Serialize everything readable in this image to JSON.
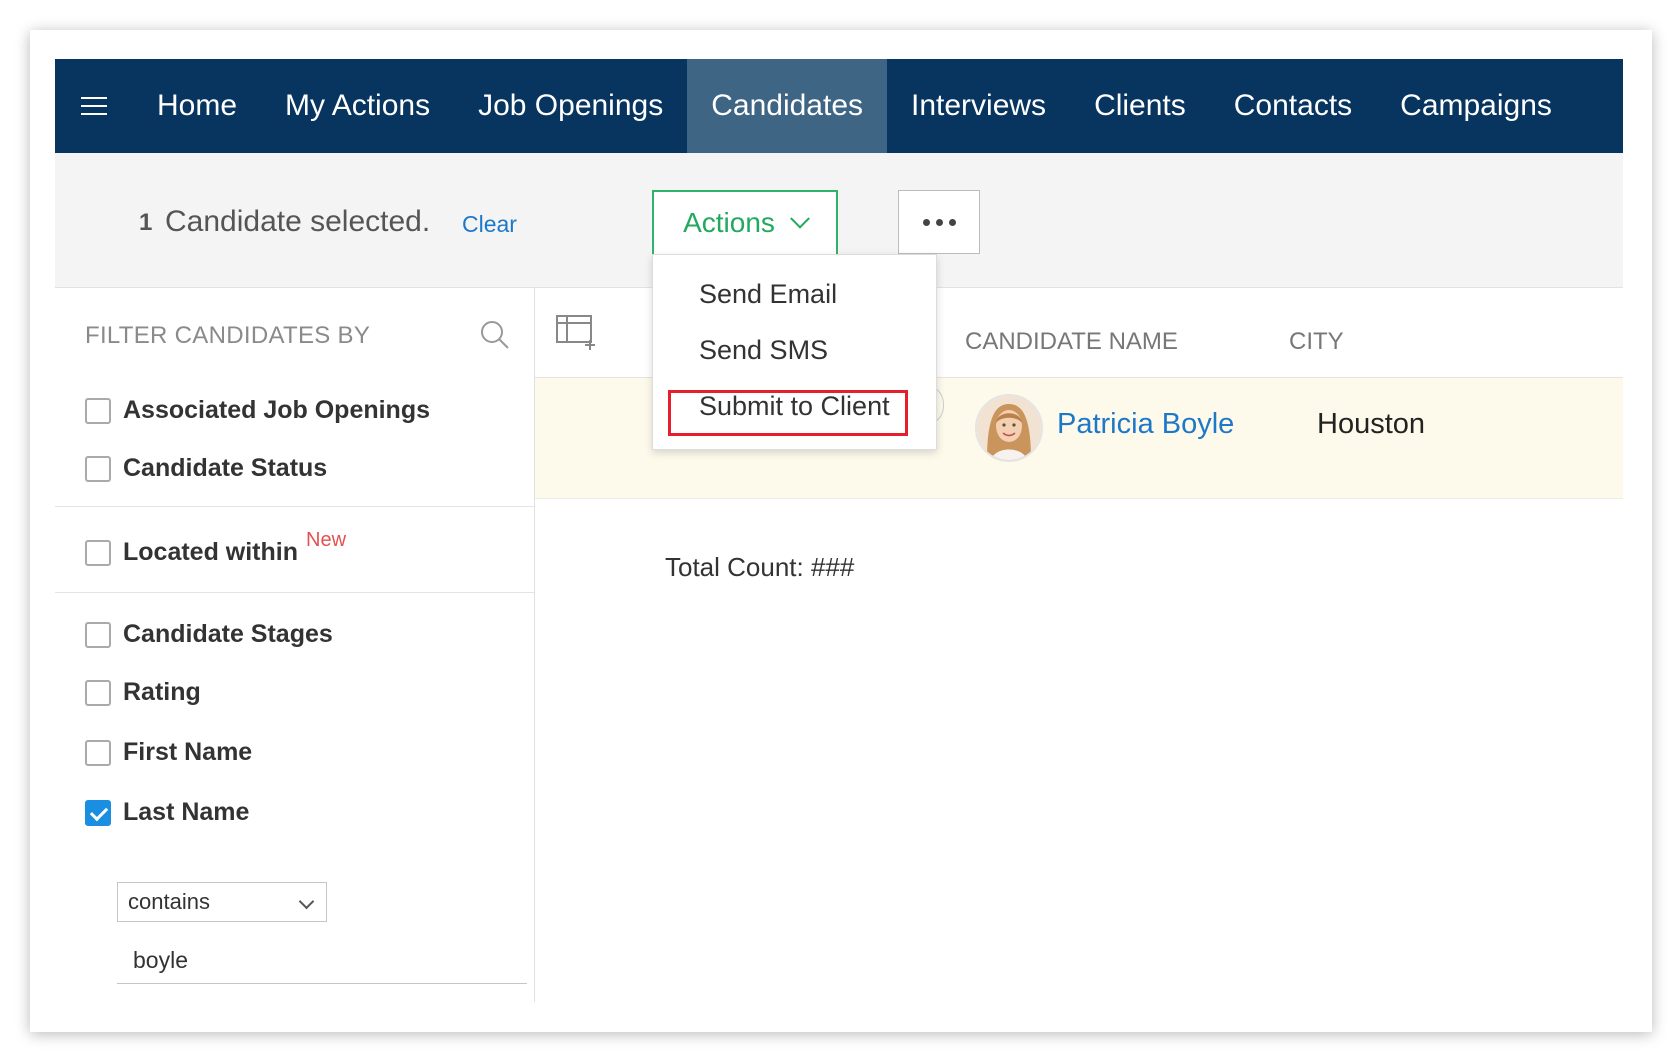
{
  "nav": {
    "items": [
      {
        "label": "Home"
      },
      {
        "label": "My Actions"
      },
      {
        "label": "Job Openings"
      },
      {
        "label": "Candidates"
      },
      {
        "label": "Interviews"
      },
      {
        "label": "Clients"
      },
      {
        "label": "Contacts"
      },
      {
        "label": "Campaigns"
      }
    ],
    "active": "Candidates"
  },
  "selection": {
    "count": "1",
    "text": "Candidate selected.",
    "clear": "Clear"
  },
  "toolbar": {
    "actions_label": "Actions"
  },
  "actions_menu": {
    "items": [
      {
        "label": "Send Email"
      },
      {
        "label": "Send SMS"
      },
      {
        "label": "Submit to Client"
      }
    ],
    "highlighted": "Submit to Client"
  },
  "filter": {
    "title": "FILTER CANDIDATES BY",
    "items": [
      {
        "label": "Associated Job Openings",
        "checked": false
      },
      {
        "label": "Candidate Status",
        "checked": false
      },
      {
        "label": "Located within",
        "checked": false,
        "badge": "New"
      },
      {
        "label": "Candidate Stages",
        "checked": false
      },
      {
        "label": "Rating",
        "checked": false
      },
      {
        "label": "First Name",
        "checked": false
      },
      {
        "label": "Last Name",
        "checked": true
      }
    ],
    "condition": "contains",
    "value": "boyle"
  },
  "table": {
    "columns": [
      "CANDIDATE NAME",
      "CITY"
    ],
    "rows": [
      {
        "name": "Patricia Boyle",
        "city": "Houston"
      }
    ],
    "total": "Total Count: ###"
  },
  "colors": {
    "nav_bg": "#07355f",
    "nav_active": "#3e6584",
    "accent_green": "#22a85f",
    "link_blue": "#1e78c8",
    "highlight_red": "#e2202e",
    "row_bg": "#fdfaec"
  }
}
